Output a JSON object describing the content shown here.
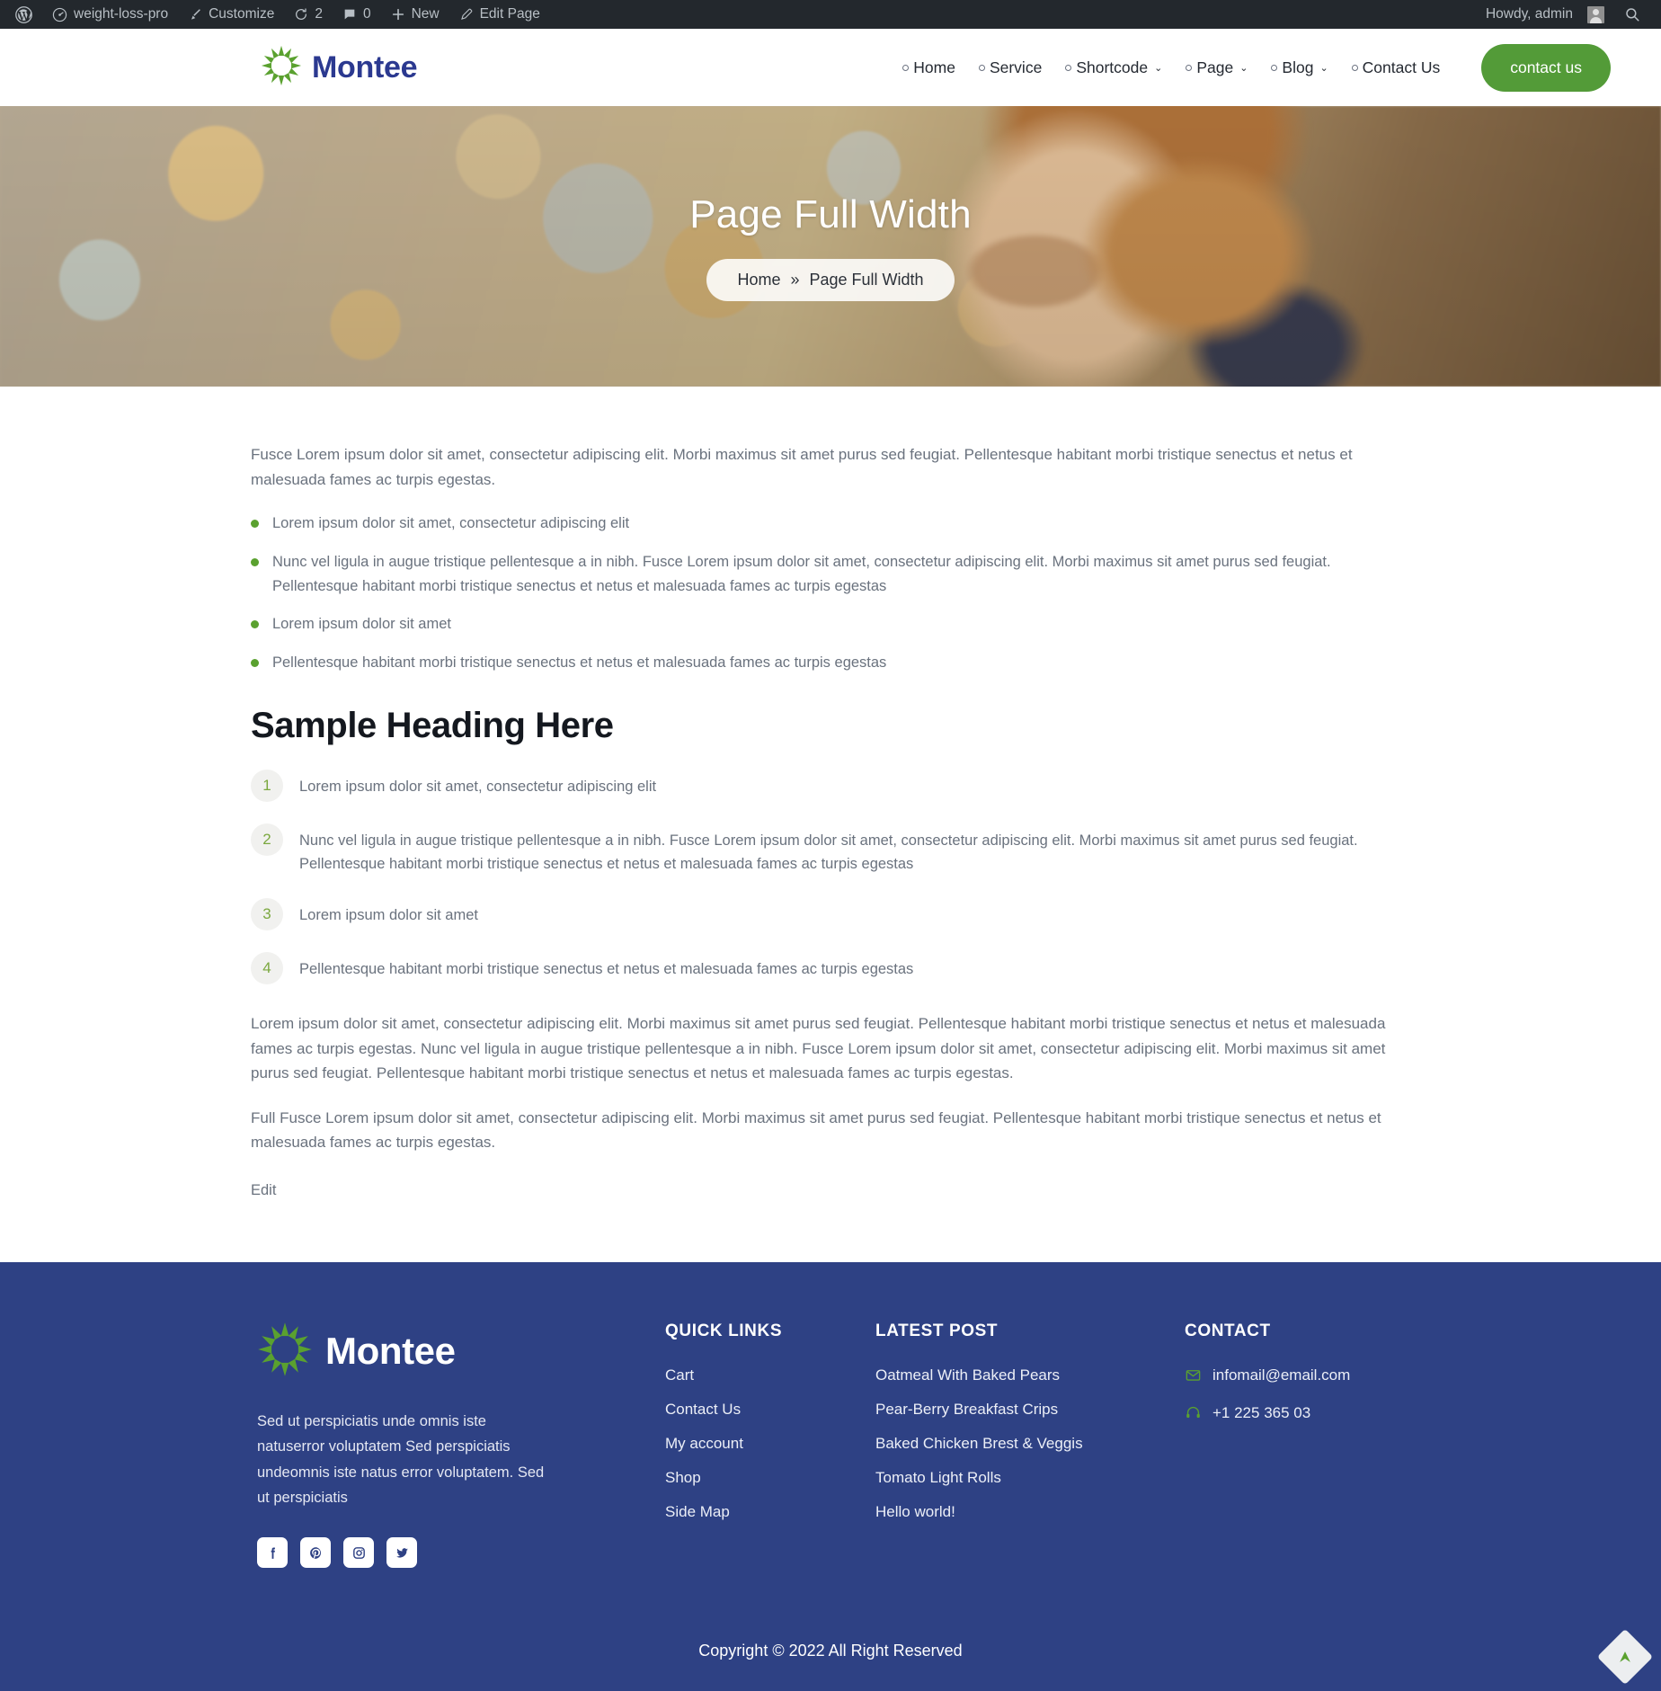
{
  "adminbar": {
    "wp_logo_icon": "wordpress-icon",
    "site_name": "weight-loss-pro",
    "site_icon": "dashboard-icon",
    "customize": "Customize",
    "customize_icon": "paintbrush-icon",
    "updates_count": "2",
    "updates_icon": "update-icon",
    "comments_count": "0",
    "comments_icon": "comment-bubble-icon",
    "new": "New",
    "new_icon": "plus-icon",
    "edit_page": "Edit Page",
    "edit_icon": "pencil-icon",
    "howdy": "Howdy, admin",
    "avatar_icon": "user-avatar-icon",
    "search_icon": "search-icon"
  },
  "header": {
    "brand": "Montee",
    "logo_icon": "sunburst-logo-icon",
    "nav": [
      {
        "label": "Home",
        "caret": ""
      },
      {
        "label": "Service",
        "caret": ""
      },
      {
        "label": "Shortcode",
        "caret": "⌄"
      },
      {
        "label": "Page",
        "caret": "⌄"
      },
      {
        "label": "Blog",
        "caret": "⌄"
      },
      {
        "label": "Contact Us",
        "caret": ""
      }
    ],
    "cta_label": "contact us"
  },
  "hero": {
    "title": "Page Full Width",
    "breadcrumb_home": "Home",
    "breadcrumb_sep": "»",
    "breadcrumb_current": "Page Full Width"
  },
  "main": {
    "intro": "Fusce Lorem ipsum dolor sit amet, consectetur adipiscing elit. Morbi maximus sit amet purus sed feugiat. Pellentesque habitant morbi tristique senectus et netus et malesuada fames ac turpis egestas.",
    "bullets": [
      "Lorem ipsum dolor sit amet, consectetur adipiscing elit",
      "Nunc vel ligula in augue tristique pellentesque a in nibh. Fusce Lorem ipsum dolor sit amet, consectetur adipiscing elit. Morbi maximus sit amet purus sed feugiat. Pellentesque habitant morbi tristique senectus et netus et malesuada fames ac turpis egestas",
      "Lorem ipsum dolor sit amet",
      "Pellentesque habitant morbi tristique senectus et netus et malesuada fames ac turpis egestas"
    ],
    "heading": "Sample Heading Here",
    "numbered": [
      {
        "num": "1",
        "text": "Lorem ipsum dolor sit amet, consectetur adipiscing elit"
      },
      {
        "num": "2",
        "text": "Nunc vel ligula in augue tristique pellentesque a in nibh. Fusce Lorem ipsum dolor sit amet, consectetur adipiscing elit. Morbi maximus sit amet purus sed feugiat. Pellentesque habitant morbi tristique senectus et netus et malesuada fames ac turpis egestas"
      },
      {
        "num": "3",
        "text": "Lorem ipsum dolor sit amet"
      },
      {
        "num": "4",
        "text": "Pellentesque habitant morbi tristique senectus et netus et malesuada fames ac turpis egestas"
      }
    ],
    "para2": "Lorem ipsum dolor sit amet, consectetur adipiscing elit. Morbi maximus sit amet purus sed feugiat. Pellentesque habitant morbi tristique senectus et netus et malesuada fames ac turpis egestas. Nunc vel ligula in augue tristique pellentesque a in nibh. Fusce Lorem ipsum dolor sit amet, consectetur adipiscing elit. Morbi maximus sit amet purus sed feugiat. Pellentesque habitant morbi tristique senectus et netus et malesuada fames ac turpis egestas.",
    "para3": "Full Fusce Lorem ipsum dolor sit amet, consectetur adipiscing elit. Morbi maximus sit amet purus sed feugiat. Pellentesque habitant morbi tristique senectus et netus et malesuada fames ac turpis egestas.",
    "edit": "Edit"
  },
  "footer": {
    "brand": "Montee",
    "logo_icon": "sunburst-logo-icon",
    "about": "Sed ut perspiciatis unde omnis iste natuserror voluptatem Sed perspiciatis undeomnis iste natus error voluptatem. Sed ut perspiciatis",
    "socials": [
      {
        "icon": "facebook-icon"
      },
      {
        "icon": "pinterest-icon"
      },
      {
        "icon": "instagram-icon"
      },
      {
        "icon": "twitter-icon"
      }
    ],
    "quick_links_title": "QUICK LINKS",
    "quick_links": [
      "Cart",
      "Contact Us",
      "My account",
      "Shop",
      "Side Map"
    ],
    "latest_post_title": "LATEST POST",
    "latest_posts": [
      "Oatmeal With Baked Pears",
      "Pear-Berry Breakfast Crips",
      "Baked Chicken Brest & Veggis",
      "Tomato Light Rolls",
      "Hello world!"
    ],
    "contact_title": "CONTACT",
    "email": "infomail@email.com",
    "email_icon": "envelope-icon",
    "phone": "+1 225 365 03",
    "phone_icon": "headset-icon",
    "copyright": "Copyright © 2022 All Right Reserved",
    "scrolltop_icon": "arrow-up-icon"
  },
  "colors": {
    "brand_blue": "#2b3990",
    "footer_blue": "#2e4184",
    "accent_green": "#539b38",
    "bullet_green": "#5aa12f",
    "admin_dark": "#23282d"
  }
}
